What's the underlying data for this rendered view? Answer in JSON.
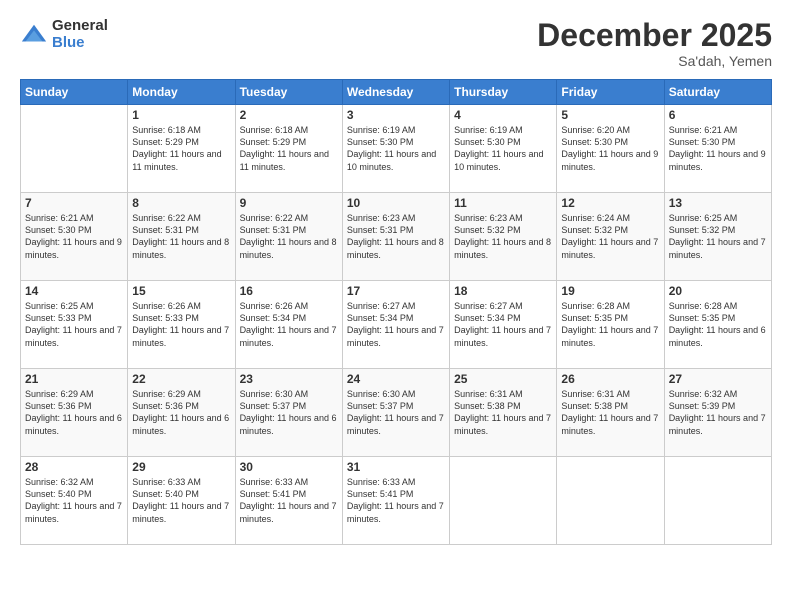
{
  "logo": {
    "general": "General",
    "blue": "Blue"
  },
  "header": {
    "month": "December 2025",
    "location": "Sa'dah, Yemen"
  },
  "weekdays": [
    "Sunday",
    "Monday",
    "Tuesday",
    "Wednesday",
    "Thursday",
    "Friday",
    "Saturday"
  ],
  "weeks": [
    [
      {
        "day": "",
        "info": ""
      },
      {
        "day": "1",
        "info": "Sunrise: 6:18 AM\nSunset: 5:29 PM\nDaylight: 11 hours\nand 11 minutes."
      },
      {
        "day": "2",
        "info": "Sunrise: 6:18 AM\nSunset: 5:29 PM\nDaylight: 11 hours\nand 11 minutes."
      },
      {
        "day": "3",
        "info": "Sunrise: 6:19 AM\nSunset: 5:30 PM\nDaylight: 11 hours\nand 10 minutes."
      },
      {
        "day": "4",
        "info": "Sunrise: 6:19 AM\nSunset: 5:30 PM\nDaylight: 11 hours\nand 10 minutes."
      },
      {
        "day": "5",
        "info": "Sunrise: 6:20 AM\nSunset: 5:30 PM\nDaylight: 11 hours\nand 9 minutes."
      },
      {
        "day": "6",
        "info": "Sunrise: 6:21 AM\nSunset: 5:30 PM\nDaylight: 11 hours\nand 9 minutes."
      }
    ],
    [
      {
        "day": "7",
        "info": "Sunrise: 6:21 AM\nSunset: 5:30 PM\nDaylight: 11 hours\nand 9 minutes."
      },
      {
        "day": "8",
        "info": "Sunrise: 6:22 AM\nSunset: 5:31 PM\nDaylight: 11 hours\nand 8 minutes."
      },
      {
        "day": "9",
        "info": "Sunrise: 6:22 AM\nSunset: 5:31 PM\nDaylight: 11 hours\nand 8 minutes."
      },
      {
        "day": "10",
        "info": "Sunrise: 6:23 AM\nSunset: 5:31 PM\nDaylight: 11 hours\nand 8 minutes."
      },
      {
        "day": "11",
        "info": "Sunrise: 6:23 AM\nSunset: 5:32 PM\nDaylight: 11 hours\nand 8 minutes."
      },
      {
        "day": "12",
        "info": "Sunrise: 6:24 AM\nSunset: 5:32 PM\nDaylight: 11 hours\nand 7 minutes."
      },
      {
        "day": "13",
        "info": "Sunrise: 6:25 AM\nSunset: 5:32 PM\nDaylight: 11 hours\nand 7 minutes."
      }
    ],
    [
      {
        "day": "14",
        "info": "Sunrise: 6:25 AM\nSunset: 5:33 PM\nDaylight: 11 hours\nand 7 minutes."
      },
      {
        "day": "15",
        "info": "Sunrise: 6:26 AM\nSunset: 5:33 PM\nDaylight: 11 hours\nand 7 minutes."
      },
      {
        "day": "16",
        "info": "Sunrise: 6:26 AM\nSunset: 5:34 PM\nDaylight: 11 hours\nand 7 minutes."
      },
      {
        "day": "17",
        "info": "Sunrise: 6:27 AM\nSunset: 5:34 PM\nDaylight: 11 hours\nand 7 minutes."
      },
      {
        "day": "18",
        "info": "Sunrise: 6:27 AM\nSunset: 5:34 PM\nDaylight: 11 hours\nand 7 minutes."
      },
      {
        "day": "19",
        "info": "Sunrise: 6:28 AM\nSunset: 5:35 PM\nDaylight: 11 hours\nand 7 minutes."
      },
      {
        "day": "20",
        "info": "Sunrise: 6:28 AM\nSunset: 5:35 PM\nDaylight: 11 hours\nand 6 minutes."
      }
    ],
    [
      {
        "day": "21",
        "info": "Sunrise: 6:29 AM\nSunset: 5:36 PM\nDaylight: 11 hours\nand 6 minutes."
      },
      {
        "day": "22",
        "info": "Sunrise: 6:29 AM\nSunset: 5:36 PM\nDaylight: 11 hours\nand 6 minutes."
      },
      {
        "day": "23",
        "info": "Sunrise: 6:30 AM\nSunset: 5:37 PM\nDaylight: 11 hours\nand 6 minutes."
      },
      {
        "day": "24",
        "info": "Sunrise: 6:30 AM\nSunset: 5:37 PM\nDaylight: 11 hours\nand 7 minutes."
      },
      {
        "day": "25",
        "info": "Sunrise: 6:31 AM\nSunset: 5:38 PM\nDaylight: 11 hours\nand 7 minutes."
      },
      {
        "day": "26",
        "info": "Sunrise: 6:31 AM\nSunset: 5:38 PM\nDaylight: 11 hours\nand 7 minutes."
      },
      {
        "day": "27",
        "info": "Sunrise: 6:32 AM\nSunset: 5:39 PM\nDaylight: 11 hours\nand 7 minutes."
      }
    ],
    [
      {
        "day": "28",
        "info": "Sunrise: 6:32 AM\nSunset: 5:40 PM\nDaylight: 11 hours\nand 7 minutes."
      },
      {
        "day": "29",
        "info": "Sunrise: 6:33 AM\nSunset: 5:40 PM\nDaylight: 11 hours\nand 7 minutes."
      },
      {
        "day": "30",
        "info": "Sunrise: 6:33 AM\nSunset: 5:41 PM\nDaylight: 11 hours\nand 7 minutes."
      },
      {
        "day": "31",
        "info": "Sunrise: 6:33 AM\nSunset: 5:41 PM\nDaylight: 11 hours\nand 7 minutes."
      },
      {
        "day": "",
        "info": ""
      },
      {
        "day": "",
        "info": ""
      },
      {
        "day": "",
        "info": ""
      }
    ]
  ]
}
